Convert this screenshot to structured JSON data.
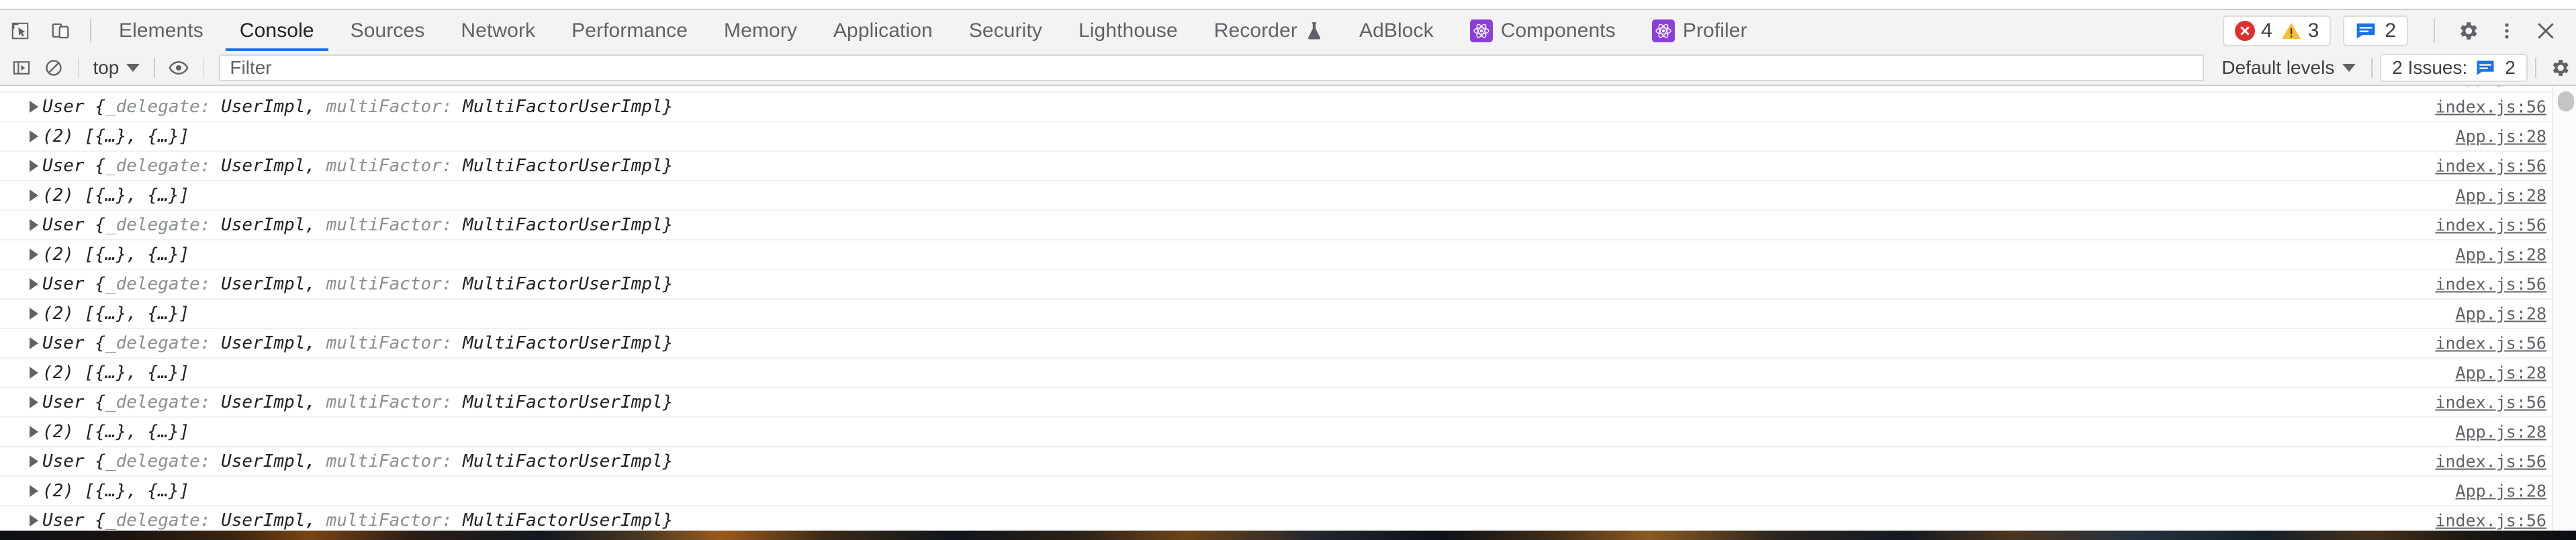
{
  "window": {
    "app": "Chrome DevTools"
  },
  "tabbar": {
    "inspect_icon": "inspect-element-icon",
    "device_icon": "device-toolbar-icon",
    "tabs": [
      {
        "label": "Elements",
        "active": false,
        "icon": null
      },
      {
        "label": "Console",
        "active": true,
        "icon": null
      },
      {
        "label": "Sources",
        "active": false,
        "icon": null
      },
      {
        "label": "Network",
        "active": false,
        "icon": null
      },
      {
        "label": "Performance",
        "active": false,
        "icon": null
      },
      {
        "label": "Memory",
        "active": false,
        "icon": null
      },
      {
        "label": "Application",
        "active": false,
        "icon": null
      },
      {
        "label": "Security",
        "active": false,
        "icon": null
      },
      {
        "label": "Lighthouse",
        "active": false,
        "icon": null
      },
      {
        "label": "Recorder",
        "active": false,
        "icon": "flask-icon"
      },
      {
        "label": "AdBlock",
        "active": false,
        "icon": null
      },
      {
        "label": "Components",
        "active": false,
        "icon": "react-icon"
      },
      {
        "label": "Profiler",
        "active": false,
        "icon": "react-icon"
      }
    ],
    "status": {
      "error_count": "4",
      "warning_count": "3",
      "message_count": "2"
    },
    "settings_icon": "gear-icon",
    "more_icon": "kebab-menu-icon",
    "close_icon": "close-icon",
    "accent_color": "#1a73e8",
    "error_color": "#df3030",
    "warning_color": "#f5bc42",
    "info_color": "#1a73e8",
    "react_badge_color": "#8c3fd4"
  },
  "console_toolbar": {
    "sidebar_toggle_icon": "console-sidebar-icon",
    "clear_icon": "clear-console-icon",
    "context": "top",
    "eye_icon": "live-expression-eye-icon",
    "filter": {
      "placeholder": "Filter",
      "value": ""
    },
    "levels": "Default levels",
    "issues": {
      "label": "2 Issues:",
      "count": "2",
      "icon": "issues-bubble-icon"
    },
    "settings_icon": "console-settings-gear-icon"
  },
  "console_log": {
    "array_message": "(2) [{…}, {…}]",
    "user_message": {
      "class": "User",
      "open": " {",
      "key1": "_delegate: ",
      "val1": "UserImpl",
      "comma": ", ",
      "key2": "multiFactor: ",
      "val2": "MultiFactorUserImpl",
      "close": "}"
    },
    "source_array": "App.js:28",
    "source_user": "index.js:56",
    "rows": [
      {
        "type": "array",
        "source": "App.js:28"
      },
      {
        "type": "user",
        "source": "index.js:56"
      },
      {
        "type": "array",
        "source": "App.js:28"
      },
      {
        "type": "user",
        "source": "index.js:56"
      },
      {
        "type": "array",
        "source": "App.js:28"
      },
      {
        "type": "user",
        "source": "index.js:56"
      },
      {
        "type": "array",
        "source": "App.js:28"
      },
      {
        "type": "user",
        "source": "index.js:56"
      },
      {
        "type": "array",
        "source": "App.js:28"
      },
      {
        "type": "user",
        "source": "index.js:56"
      },
      {
        "type": "array",
        "source": "App.js:28"
      },
      {
        "type": "user",
        "source": "index.js:56"
      },
      {
        "type": "array",
        "source": "App.js:28"
      },
      {
        "type": "user",
        "source": "index.js:56"
      },
      {
        "type": "array",
        "source": "App.js:28"
      },
      {
        "type": "user",
        "source": "index.js:56"
      }
    ]
  }
}
